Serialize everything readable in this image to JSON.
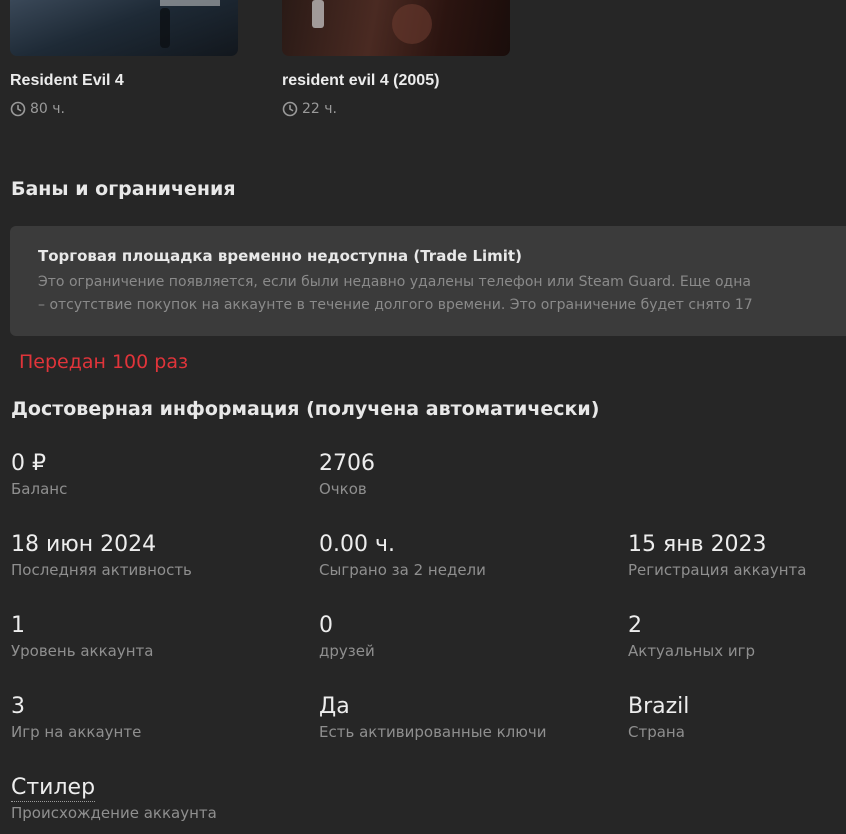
{
  "games": [
    {
      "title": "Resident Evil 4",
      "hours": "80 ч."
    },
    {
      "title": "resident evil 4 (2005)",
      "hours": "22 ч."
    }
  ],
  "bans": {
    "section_title": "Баны и ограничения",
    "trade_title": "Торговая площадка временно недоступна (Trade Limit)",
    "trade_line1": "Это ограничение появляется, если были недавно удалены телефон или Steam Guard. Еще одна",
    "trade_line2": "– отсутствие покупок на аккаунте в течение долгого времени. Это ограничение будет снято 17"
  },
  "transferred_text": "Передан 100 раз",
  "info": {
    "title": "Достоверная информация (получена автоматически)",
    "stats": [
      {
        "value": "0 ₽",
        "label": "Баланс"
      },
      {
        "value": "2706",
        "label": "Очков"
      },
      {
        "value": "18 июн 2024",
        "label": "Последняя активность"
      },
      {
        "value": "0.00 ч.",
        "label": "Сыграно за 2 недели"
      },
      {
        "value": "15 янв 2023",
        "label": "Регистрация аккаунта"
      },
      {
        "value": "1",
        "label": "Уровень аккаунта"
      },
      {
        "value": "0",
        "label": "друзей"
      },
      {
        "value": "2",
        "label": "Актуальных игр"
      },
      {
        "value": "3",
        "label": "Игр на аккаунте"
      },
      {
        "value": "Да",
        "label": "Есть активированные ключи"
      },
      {
        "value": "Brazil",
        "label": "Страна"
      },
      {
        "value": "Стилер",
        "label": "Происхождение аккаунта"
      }
    ]
  },
  "colors": {
    "background": "#262626",
    "panel": "#3b3b3b",
    "alert_red": "#e0343a",
    "muted_text": "#8f8f8f"
  },
  "icons": {
    "hours": "clock-icon"
  }
}
